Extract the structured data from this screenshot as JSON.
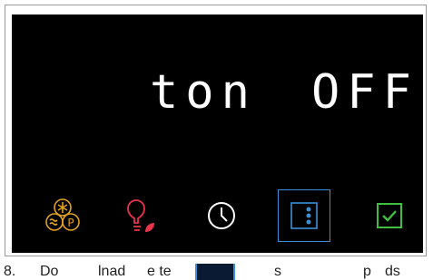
{
  "display": {
    "left_text": "ton",
    "right_text": "OFF"
  },
  "buttons": [
    {
      "name": "supercool-party-button",
      "icon": "snowflake-party-icon",
      "color": "#e0a020"
    },
    {
      "name": "light-button",
      "icon": "lightbulb-eco-icon",
      "color": "#e8334a"
    },
    {
      "name": "timer-button",
      "icon": "clock-icon",
      "color": "#ffffff"
    },
    {
      "name": "menu-button",
      "icon": "three-dots-menu-icon",
      "color": "#3d8fd6",
      "selected": true
    },
    {
      "name": "confirm-button",
      "icon": "checkbox-check-icon",
      "color": "#3fbf3f"
    }
  ],
  "caption": {
    "step": "8.",
    "word1": "Do",
    "word2": "lnad",
    "word3": "e te",
    "word4": "s",
    "word5": "p",
    "word6": "ds"
  }
}
